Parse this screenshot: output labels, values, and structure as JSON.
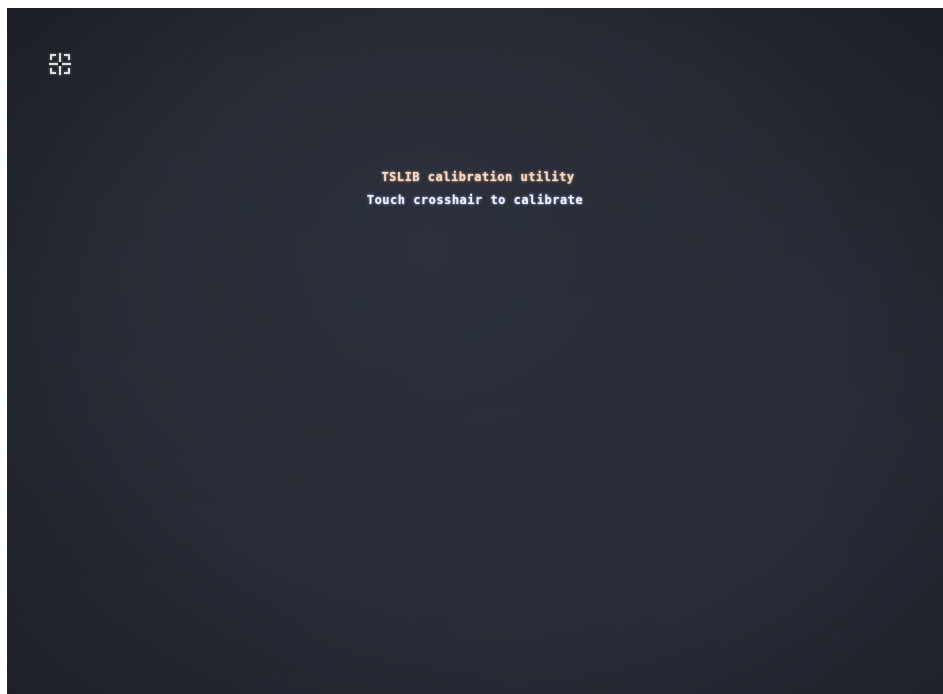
{
  "screen": {
    "title": "TSLIB calibration utility",
    "instruction": "Touch crosshair to calibrate",
    "background_color": "#252932",
    "title_color": "#f6d9c2",
    "instruction_color": "#eef0ff"
  },
  "target": {
    "icon": "crosshair-icon",
    "color": "#ffffff"
  }
}
